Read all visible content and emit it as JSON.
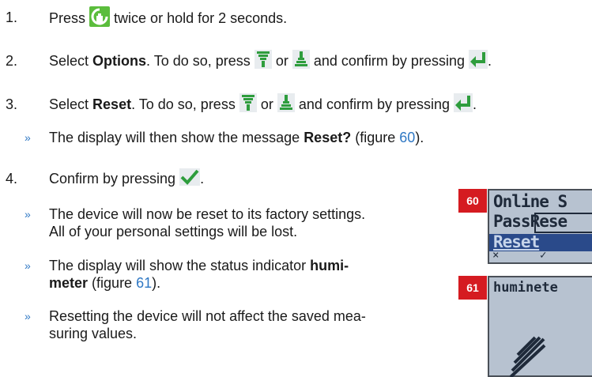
{
  "steps": [
    {
      "number": "1.",
      "text_before": "Press",
      "text_after": "twice or hold for 2 seconds.",
      "icon": "menu-button-icon"
    },
    {
      "number": "2.",
      "text_select": "Select",
      "bold": "Options",
      "text_mid": ". To do so, press",
      "or": "or",
      "confirm": "and confirm by pressing",
      "end": "."
    },
    {
      "number": "3.",
      "text_select": "Select",
      "bold": "Reset",
      "text_mid": ". To do so, press",
      "or": "or",
      "confirm": "and confirm by pressing",
      "end": "."
    },
    {
      "number": "4.",
      "text_before": "Confirm by pressing",
      "end": ".",
      "icon": "checkmark-button-icon"
    }
  ],
  "notes": {
    "bullet_symbol": "»",
    "display_msg": {
      "before": "The display will then show the message",
      "bold": "Reset?",
      "paren_open": "(figure",
      "ref": "60",
      "paren_close": ")."
    },
    "reset_line1": "The device will now be reset to its factory settings.",
    "reset_line2": "All of your personal settings will be lost.",
    "status": {
      "before": "The display will show the status indicator",
      "bold1": "humi-",
      "bold2": "meter",
      "paren_open": "(figure",
      "ref": "61",
      "paren_close": ")."
    },
    "saved_line1": "Resetting the device will not affect the saved mea-",
    "saved_line2": "suring values."
  },
  "figures": [
    {
      "label": "60",
      "lines": [
        "Online S",
        "PassRese",
        "Reset"
      ],
      "soft_keys": [
        "×",
        "✓"
      ]
    },
    {
      "label": "61",
      "lines": [
        "huminete"
      ]
    }
  ],
  "colors": {
    "accent_blue": "#2f78c4",
    "figure_red": "#d51b21",
    "lcd_bg": "#b7c2d0"
  }
}
